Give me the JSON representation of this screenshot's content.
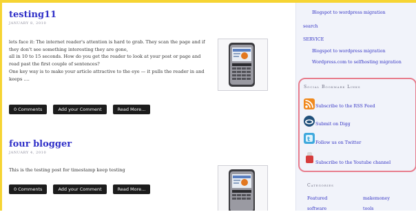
{
  "posts": [
    {
      "title": "testing11",
      "date": "JANUARY 8, 2010",
      "paragraphs": [
        "lets face it: The internet reader's attention is hard to grab. They scan the page and if they don't see something interesting they are gone,",
        "all in 10 to 15 seconds. How do you get the reader to look at your post or page and read past the first couple of sentences?",
        "One key way is to make your article attractive to the eye — it pulls the reader in and keeps ...."
      ],
      "buttons": [
        "0 Comments",
        "Add your Comment",
        "Read More..."
      ]
    },
    {
      "title": "four blogger",
      "date": "JANUARY 4, 2010",
      "paragraphs": [
        "This is the testing post for timestamp keep testing"
      ],
      "buttons": [
        "0 Comments",
        "Add your Comment",
        "Read More..."
      ]
    }
  ],
  "sidebar": {
    "top_links": [
      "Blogspot to wordpress migration",
      "search",
      "SERVICE",
      "Blogspot to wordpress migration",
      "Wordpress.com to selfhosting migration"
    ],
    "social": {
      "heading": "Social Bookmark Links",
      "links": [
        {
          "label": "Subscribe to the RSS Feed",
          "icon": "rss-icon"
        },
        {
          "label": "Submit on Digg",
          "icon": "digg-icon"
        },
        {
          "label": "Follow us on Twitter",
          "icon": "twitter-icon"
        },
        {
          "label": "Subscribe to the Youtube channel",
          "icon": "youtube-icon"
        }
      ]
    },
    "categories": {
      "heading": "Categories",
      "items": [
        "Featured",
        "makemoney",
        "software",
        "tools"
      ]
    }
  },
  "colors": {
    "frame": "#f6d433",
    "link": "#3434c4",
    "title": "#3030c8",
    "button": "#1c1c1c",
    "social_border": "#e87c8c",
    "sidebar_bg": "#f1f3fa"
  }
}
